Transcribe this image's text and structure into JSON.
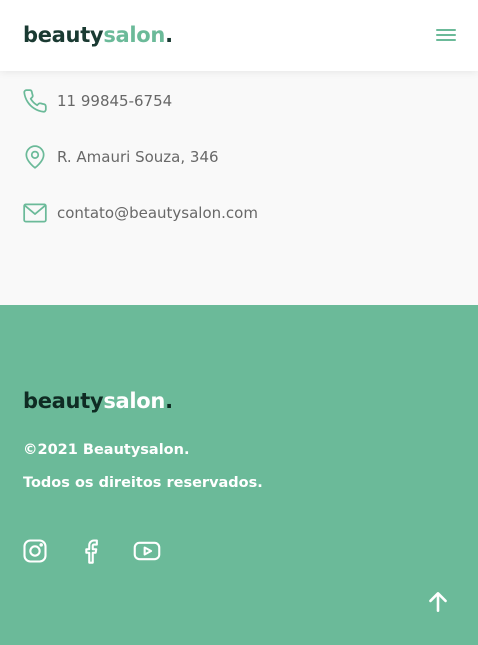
{
  "header": {
    "logo": {
      "part1": "beauty",
      "part2": "salon",
      "part3": "."
    }
  },
  "contact": {
    "phone": "11 99845-6754",
    "address": "R. Amauri Souza, 346",
    "email": "contato@beautysalon.com"
  },
  "footer": {
    "logo": {
      "part1": "beauty",
      "part2": "salon",
      "part3": "."
    },
    "copyright": "©2021 Beautysalon.",
    "rights": "Todos os direitos reservados."
  },
  "colors": {
    "accent": "#6bba99",
    "dark": "#1a3a32",
    "text_gray": "#686868",
    "white": "#ffffff"
  },
  "icons": {
    "menu": "hamburger-menu-icon",
    "phone": "phone-icon",
    "location": "map-pin-icon",
    "email": "mail-icon",
    "instagram": "instagram-icon",
    "facebook": "facebook-icon",
    "youtube": "youtube-icon",
    "back_to_top": "arrow-up-icon"
  }
}
